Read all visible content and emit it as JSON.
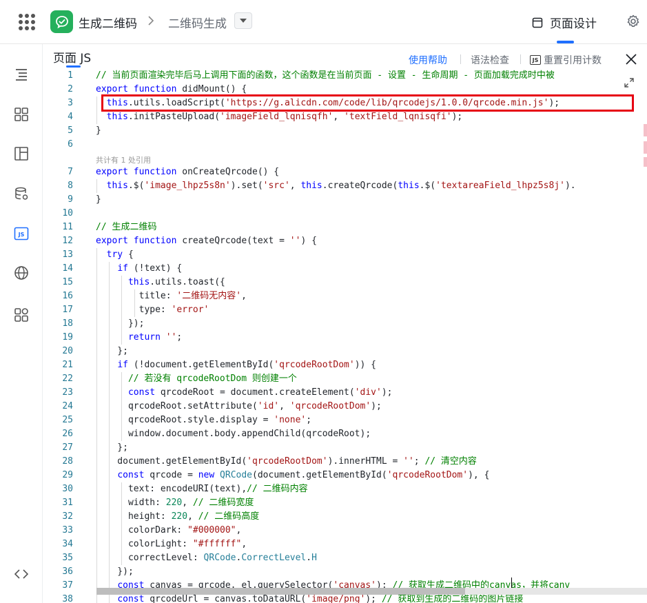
{
  "header": {
    "app_title": "生成二维码",
    "crumb_separator": ">",
    "page_name": "二维码生成",
    "design_tab_label": "页面设计"
  },
  "panel": {
    "title": "页面 JS",
    "help_label": "使用帮助",
    "syntax_check_label": "语法检查",
    "reset_ref_label": "重置引用计数",
    "js_badge": "JS",
    "ref_hint": "共计有 1 处引用"
  },
  "code_lines": [
    {
      "n": "1",
      "text": "// 当前页面渲染完毕后马上调用下面的函数，这个函数是在当前页面 - 设置 - 生命周期 - 页面加载完成时中被"
    },
    {
      "n": "2",
      "text": "export function didMount() {"
    },
    {
      "n": "3",
      "text": "  this.utils.loadScript('https://g.alicdn.com/code/lib/qrcodejs/1.0.0/qrcode.min.js');"
    },
    {
      "n": "4",
      "text": "  this.initPasteUpload('imageField_lqnisqfh', 'textField_lqnisqfi');"
    },
    {
      "n": "5",
      "text": "}"
    },
    {
      "n": "6",
      "text": ""
    },
    {
      "n": "7",
      "text": "export function onCreateQrcode() {"
    },
    {
      "n": "8",
      "text": "  this.$('image_lhpz5s8n').set('src', this.createQrcode(this.$('textareaField_lhpz5s8j')."
    },
    {
      "n": "9",
      "text": "}"
    },
    {
      "n": "10",
      "text": ""
    },
    {
      "n": "11",
      "text": "// 生成二维码"
    },
    {
      "n": "12",
      "text": "export function createQrcode(text = '') {"
    },
    {
      "n": "13",
      "text": "  try {"
    },
    {
      "n": "14",
      "text": "    if (!text) {"
    },
    {
      "n": "15",
      "text": "      this.utils.toast({"
    },
    {
      "n": "16",
      "text": "        title: '二维码无内容',"
    },
    {
      "n": "17",
      "text": "        type: 'error'"
    },
    {
      "n": "18",
      "text": "      });"
    },
    {
      "n": "19",
      "text": "      return '';"
    },
    {
      "n": "20",
      "text": "    };"
    },
    {
      "n": "21",
      "text": "    if (!document.getElementById('qrcodeRootDom')) {"
    },
    {
      "n": "22",
      "text": "      // 若没有 qrcodeRootDom 则创建一个"
    },
    {
      "n": "23",
      "text": "      const qrcodeRoot = document.createElement('div');"
    },
    {
      "n": "24",
      "text": "      qrcodeRoot.setAttribute('id', 'qrcodeRootDom');"
    },
    {
      "n": "25",
      "text": "      qrcodeRoot.style.display = 'none';"
    },
    {
      "n": "26",
      "text": "      window.document.body.appendChild(qrcodeRoot);"
    },
    {
      "n": "27",
      "text": "    };"
    },
    {
      "n": "28",
      "text": "    document.getElementById('qrcodeRootDom').innerHTML = ''; // 清空内容"
    },
    {
      "n": "29",
      "text": "    const qrcode = new QRCode(document.getElementById('qrcodeRootDom'), {"
    },
    {
      "n": "30",
      "text": "      text: encodeURI(text),// 二维码内容"
    },
    {
      "n": "31",
      "text": "      width: 220, // 二维码宽度"
    },
    {
      "n": "32",
      "text": "      height: 220, // 二维码高度"
    },
    {
      "n": "33",
      "text": "      colorDark: \"#000000\","
    },
    {
      "n": "34",
      "text": "      colorLight: \"#ffffff\","
    },
    {
      "n": "35",
      "text": "      correctLevel: QRCode.CorrectLevel.H"
    },
    {
      "n": "36",
      "text": "    });"
    },
    {
      "n": "37",
      "text": "    const canvas = qrcode._el.querySelector('canvas'); // 获取生成二维码中的canvas，并将canv"
    },
    {
      "n": "38",
      "text": "    const qrcodeUrl = canvas.toDataURL('image/png'); // 获取到生成的二维码的图片链接"
    }
  ],
  "colors": {
    "accent": "#1f6fff",
    "brand_green": "#25b05c",
    "highlight_red": "#e60012"
  },
  "icons": {
    "apps": "apps-grid-icon",
    "logo": "wechat-bubble-icon",
    "design": "browser-window-icon",
    "settings": "gear-icon",
    "close": "close-icon",
    "expand": "expand-icon"
  }
}
